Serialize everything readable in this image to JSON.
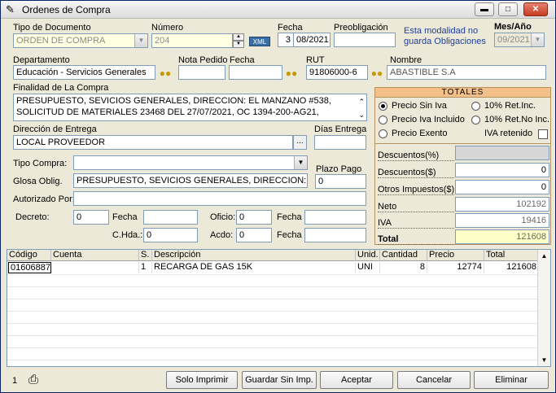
{
  "window": {
    "title": "Ordenes de Compra"
  },
  "header": {
    "tipo_label": "Tipo de Documento",
    "tipo_value": "ORDEN DE COMPRA",
    "numero_label": "Número",
    "numero_value": "204",
    "xml_label": "XML",
    "fecha_label": "Fecha",
    "fecha_day": "3",
    "fecha_month": "08/2021",
    "preob_label": "Preobligación",
    "preob_value": "",
    "note": "Esta modalidad no guarda Obligaciones",
    "mes_label": "Mes/Año",
    "mes_value": "09/2021"
  },
  "row2": {
    "depto_label": "Departamento",
    "depto_value": "Educación - Servicios Generales",
    "nota_label": "Nota Pedido",
    "nota_value": "",
    "fecha2_label": "Fecha",
    "fecha2_value": "",
    "rut_label": "RUT",
    "rut_value": "91806000-6",
    "nombre_label": "Nombre",
    "nombre_value": "ABASTIBLE S.A"
  },
  "finalidad": {
    "label": "Finalidad de La Compra",
    "line1": "PRESUPUESTO, SEVICIOS GENERALES, DIRECCION: EL MANZANO #538,",
    "line2": "SOLICITUD DE MATERIALES 23468 DEL 27/07/2021, OC 1394-200-AG21,"
  },
  "entrega": {
    "label": "Dirección de Entrega",
    "value": "LOCAL PROVEEDOR",
    "dias_label": "Días Entrega",
    "dias_value": "",
    "browse": "..."
  },
  "tipo_compra": {
    "label": "Tipo Compra:",
    "value": ""
  },
  "glosa": {
    "label": "Glosa Oblig.",
    "value": "PRESUPUESTO, SEVICIOS GENERALES, DIRECCION: EI",
    "plazo_label": "Plazo Pago",
    "plazo_value": "0"
  },
  "autorizado": {
    "label": "Autorizado Por:",
    "value": ""
  },
  "decreto": {
    "decreto_label": "Decreto:",
    "decreto_value": "0",
    "fecha_label": "Fecha",
    "fecha_value": "",
    "oficio_label": "Oficio:",
    "oficio_value": "0",
    "fecha3_label": "Fecha",
    "fecha3_value": "",
    "chda_label": "C.Hda.:",
    "chda_value": "0",
    "acdo_label": "Acdo:",
    "acdo_value": "0",
    "fecha4_label": "Fecha",
    "fecha4_value": ""
  },
  "totales": {
    "title": "TOTALES",
    "opt1": "Precio Sin Iva",
    "opt2": "10% Ret.Inc.",
    "opt3": "Precio Iva Incluido",
    "opt4": "10% Ret.No Inc.",
    "opt5": "Precio Exento",
    "iva_retenido": "IVA retenido",
    "desc_pct_label": "Descuentos(%)",
    "desc_pct_value": "",
    "desc_amt_label": "Descuentos($)",
    "desc_amt_value": "0",
    "otros_label": "Otros Impuestos($)",
    "otros_value": "0",
    "neto_label": "Neto",
    "neto_value": "102192",
    "iva_label": "IVA",
    "iva_value": "19416",
    "total_label": "Total",
    "total_value": "121608"
  },
  "grid": {
    "headers": [
      "Código",
      "Cuenta",
      "S.",
      "Descripción",
      "Unid.",
      "Cantidad",
      "Precio",
      "Total"
    ],
    "rows": [
      [
        "01606887",
        "",
        "1",
        "RECARGA DE GAS 15K",
        "UNI",
        "8",
        "12774",
        "121608"
      ]
    ]
  },
  "footer": {
    "count": "1",
    "solo_imprimir": "Solo Imprimir",
    "guardar": "Guardar Sin Imp.",
    "aceptar": "Aceptar",
    "cancelar": "Cancelar",
    "eliminar": "Eliminar"
  }
}
